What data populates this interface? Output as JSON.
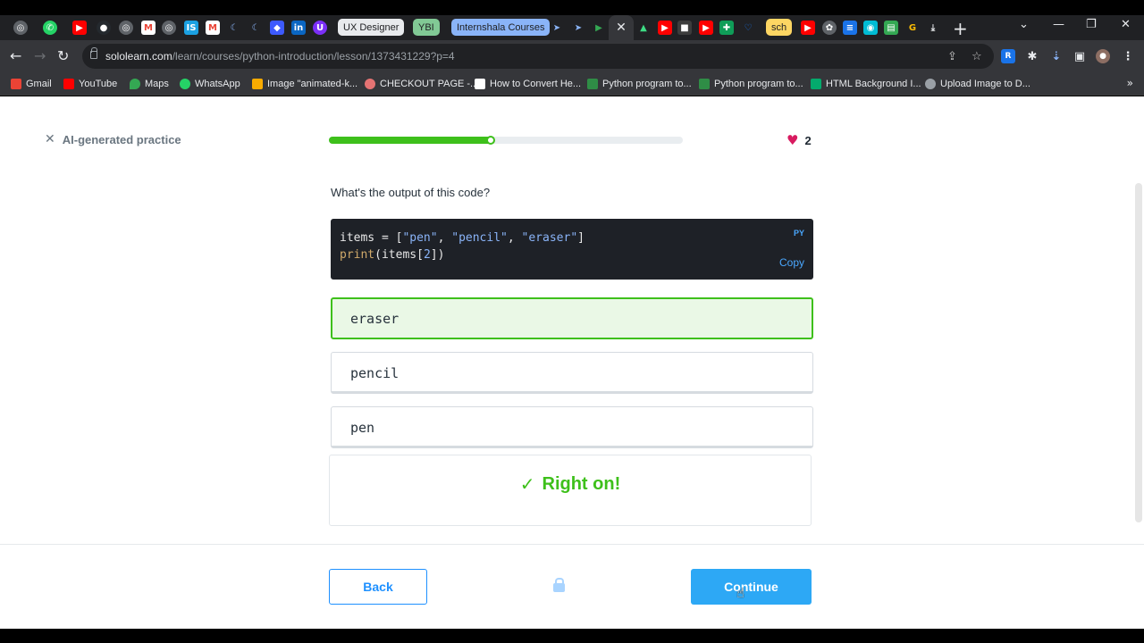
{
  "browser": {
    "tabs": {
      "pills": [
        {
          "label": "UX Designer",
          "bg": "#e8eaed",
          "fg": "#202124"
        },
        {
          "label": "YBI",
          "bg": "#81c995",
          "fg": "#202124"
        },
        {
          "label": "Internshala Courses",
          "bg": "#8ab4f8",
          "fg": "#202124"
        },
        {
          "label": "sch",
          "bg": "#fdd663",
          "fg": "#202124"
        }
      ],
      "close_glyph": "✕",
      "new_tab_glyph": "+"
    },
    "window_controls": {
      "tab_search": "⌄",
      "minimize": "—",
      "restore": "❐",
      "close": "✕"
    },
    "nav": {
      "back": "←",
      "forward": "→",
      "reload": "↻"
    },
    "address": {
      "host": "sololearn.com",
      "path": "/learn/courses/python-introduction/lesson/1373431229?p=4"
    },
    "bookmarks": [
      {
        "label": "Gmail",
        "color": "#ea4335"
      },
      {
        "label": "YouTube",
        "color": "#ff0000"
      },
      {
        "label": "Maps",
        "color": "#34a853"
      },
      {
        "label": "WhatsApp",
        "color": "#25d366"
      },
      {
        "label": "Image \"animated-k...",
        "color": "#f9ab00"
      },
      {
        "label": "CHECKOUT PAGE -...",
        "color": "#e57373"
      },
      {
        "label": "How to Convert He...",
        "color": "#ffffff"
      },
      {
        "label": "Python program to...",
        "color": "#2f8d46"
      },
      {
        "label": "Python program to...",
        "color": "#2f8d46"
      },
      {
        "label": "HTML Background I...",
        "color": "#04aa6d"
      },
      {
        "label": "Upload Image to D...",
        "color": "#9aa0a6"
      }
    ],
    "bookmarks_more": "»"
  },
  "lesson": {
    "close_label": "AI-generated practice",
    "progress": 0.46,
    "hearts": "2",
    "question": "What's the output of this code?",
    "code": {
      "lang": "PY",
      "copy_label": "Copy"
    },
    "options": [
      {
        "label": "eraser",
        "state": "correct"
      },
      {
        "label": "pencil",
        "state": "default"
      },
      {
        "label": "pen",
        "state": "default"
      }
    ],
    "feedback": "Right on!",
    "back_label": "Back",
    "continue_label": "Continue"
  },
  "colors": {
    "accent_green": "#3ec01b",
    "accent_blue": "#2da8f5",
    "heart": "#d81b60"
  }
}
